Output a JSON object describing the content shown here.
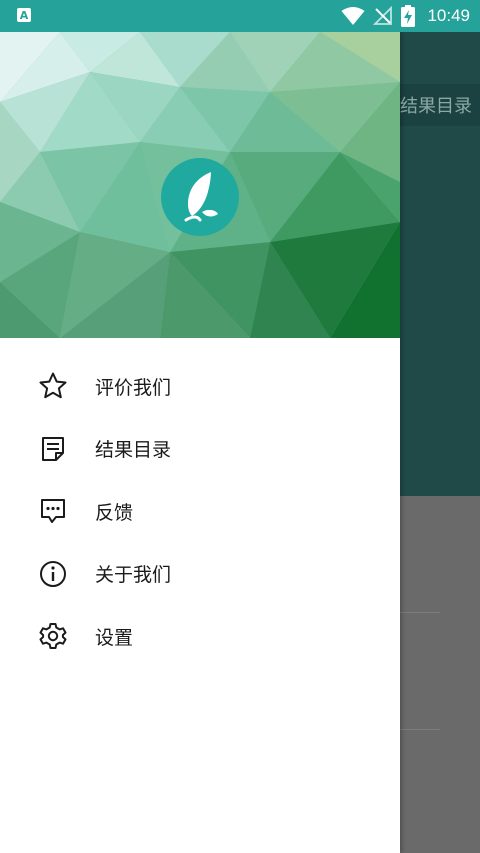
{
  "status_bar": {
    "app_badge": "A",
    "time": "10:49",
    "icons": [
      "wifi-icon",
      "no-signal-icon",
      "battery-charging-icon"
    ]
  },
  "background": {
    "toolbar_label": "结果目录",
    "colors": {
      "toolbar": "#1f4a48",
      "content": "#6a6a6a"
    }
  },
  "drawer": {
    "header": {
      "logo_icon": "feather-icon",
      "colors": {
        "logo_bg": "#20a99f"
      }
    },
    "menu": [
      {
        "label": "评价我们",
        "icon": "star-icon"
      },
      {
        "label": "结果目录",
        "icon": "note-icon"
      },
      {
        "label": "反馈",
        "icon": "chat-bubble-icon"
      },
      {
        "label": "关于我们",
        "icon": "info-icon"
      },
      {
        "label": "设置",
        "icon": "gear-icon"
      }
    ]
  },
  "colors": {
    "accent": "#25a39b"
  }
}
